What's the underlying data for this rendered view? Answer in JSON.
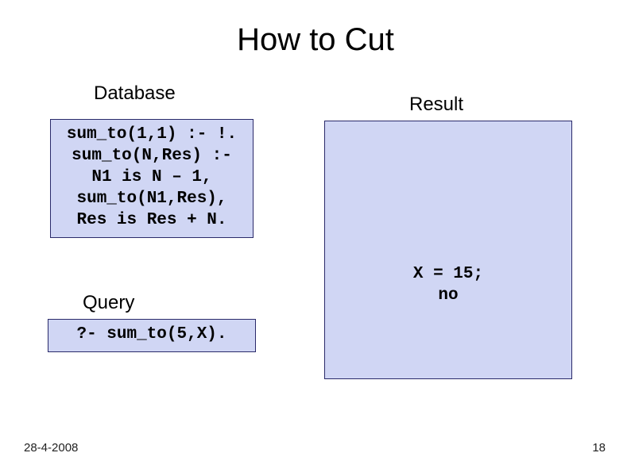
{
  "title": "How to Cut",
  "labels": {
    "database": "Database",
    "result": "Result",
    "query": "Query"
  },
  "database_code": "sum_to(1,1) :- !.\nsum_to(N,Res) :-\nN1 is N – 1,\nsum_to(N1,Res),\nRes is Res + N.",
  "result_code": "X = 15;\nno",
  "query_code": "?- sum_to(5,X).",
  "footer": {
    "date": "28-4-2008",
    "page": "18"
  },
  "colors": {
    "box_bg": "#d0d6f4",
    "box_border": "#2a2a6a"
  }
}
